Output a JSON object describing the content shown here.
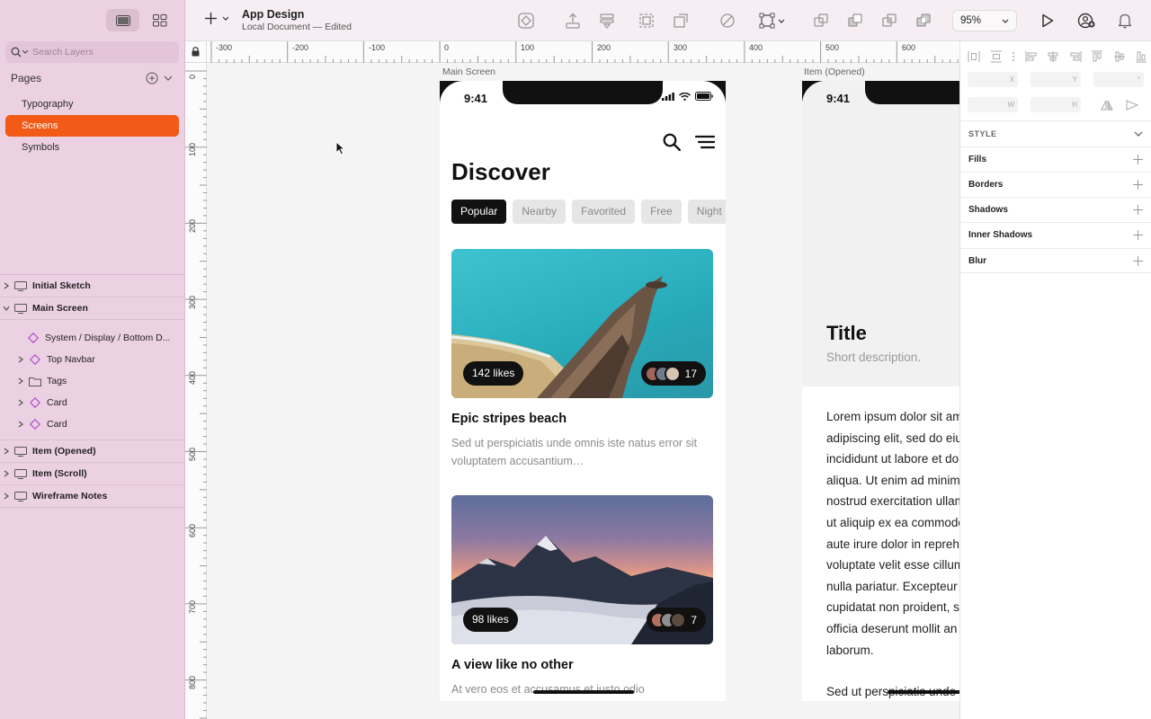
{
  "app": {
    "document_name": "App Design",
    "document_status": "Local Document — Edited"
  },
  "sidebar": {
    "search_placeholder": "Search Layers",
    "pages_label": "Pages",
    "pages": [
      "Typography",
      "Screens",
      "Symbols"
    ],
    "selected_page": "Screens",
    "layers": [
      {
        "label": "Initial Sketch",
        "level": 0,
        "icon": "artboard-icon",
        "expanded": false
      },
      {
        "label": "Main Screen",
        "level": 0,
        "icon": "artboard-icon",
        "expanded": true
      },
      {
        "label": "System / Display / Bottom D...",
        "level": 1,
        "icon": "symbol-icon",
        "expanded": null
      },
      {
        "label": "Top Navbar",
        "level": 1,
        "icon": "symbol-icon",
        "expanded": false
      },
      {
        "label": "Tags",
        "level": 1,
        "icon": "folder-icon",
        "expanded": false
      },
      {
        "label": "Card",
        "level": 1,
        "icon": "symbol-icon",
        "expanded": false
      },
      {
        "label": "Card",
        "level": 1,
        "icon": "symbol-icon",
        "expanded": false
      },
      {
        "label": "Item (Opened)",
        "level": 0,
        "icon": "artboard-icon",
        "expanded": false
      },
      {
        "label": "Item (Scroll)",
        "level": 0,
        "icon": "artboard-icon",
        "expanded": false
      },
      {
        "label": "Wireframe Notes",
        "level": 0,
        "icon": "artboard-icon",
        "expanded": false
      }
    ]
  },
  "toolbar": {
    "zoom": "95%"
  },
  "rulers": {
    "horizontal": [
      "-300",
      "-200",
      "-100",
      "0",
      "100",
      "200",
      "300",
      "400",
      "500",
      "600"
    ],
    "vertical": [
      "0",
      "100",
      "200",
      "300",
      "400",
      "500",
      "600",
      "700",
      "800"
    ]
  },
  "main_screen": {
    "label": "Main Screen",
    "time": "9:41",
    "heading": "Discover",
    "tags": [
      "Popular",
      "Nearby",
      "Favorited",
      "Free",
      "Night"
    ],
    "active_tag": "Popular",
    "cards": [
      {
        "likes": "142 likes",
        "avatar_count": "17",
        "title": "Epic stripes beach",
        "description": "Sed ut perspiciatis unde omnis iste natus error sit voluptatem accusantium…"
      },
      {
        "likes": "98 likes",
        "avatar_count": "7",
        "title": "A view like no other",
        "description": "At vero eos et accusamus et iusto odio"
      }
    ]
  },
  "item_opened": {
    "label": "Item (Opened)",
    "time": "9:41",
    "title": "Title",
    "subtitle": "Short description.",
    "body": "Lorem ipsum dolor sit am\nadipiscing elit, sed do eiu\nincididunt ut labore et do\naliqua. Ut enim ad minim\nnostrud exercitation ullam\nut aliquip ex ea commodo\naute irure dolor in repreh\nvoluptate velit esse cillum\nnulla pariatur. Excepteur\ncupidatat non proident, s\nofficia deserunt mollit an\nlaborum.",
    "body2": "Sed ut perspiciatis unde"
  },
  "inspector": {
    "geometry_labels": [
      "X",
      "Y",
      "°",
      "W",
      "H"
    ],
    "style_label": "STYLE",
    "sections": [
      "Fills",
      "Borders",
      "Shadows",
      "Inner Shadows",
      "Blur"
    ]
  }
}
